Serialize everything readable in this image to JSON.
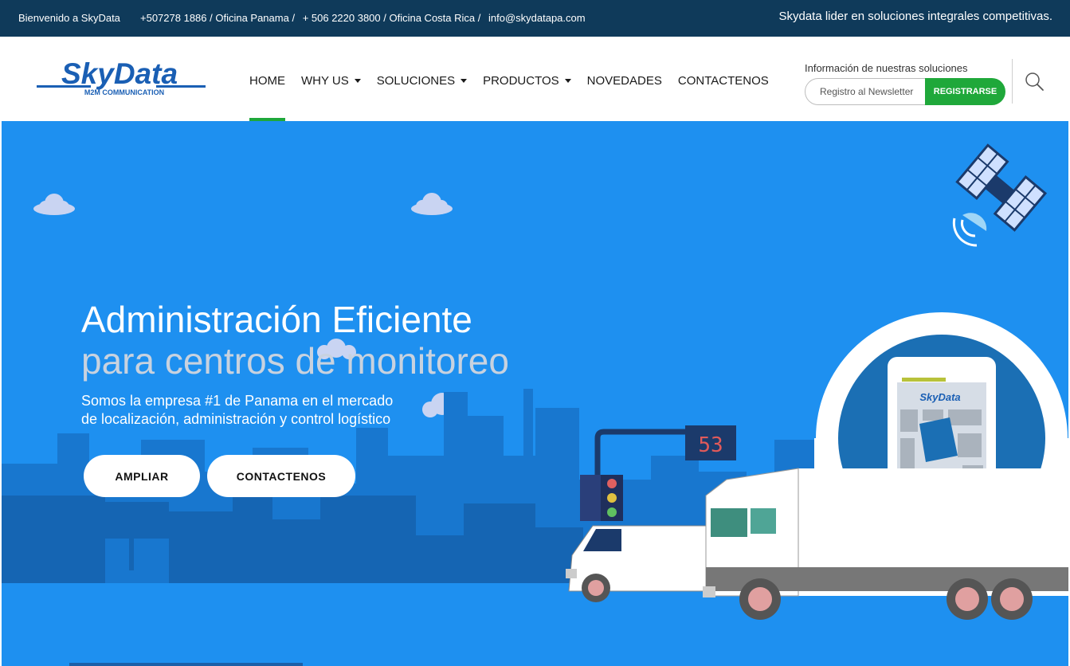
{
  "topbar": {
    "welcome": "Bienvenido a SkyData",
    "contacts": [
      "+507278 1886 / Oficina Panama /",
      "+ 506 2220 3800 / Oficina Costa Rica /",
      "info@skydatapa.com"
    ],
    "tagline": "Skydata lider en soluciones integrales competitivas."
  },
  "header": {
    "logo_text": "SkyData",
    "logo_tagline": "M2M COMMUNICATION",
    "nav": [
      {
        "label": "HOME",
        "dropdown": false,
        "active": true
      },
      {
        "label": "WHY US",
        "dropdown": true
      },
      {
        "label": "SOLUCIONES",
        "dropdown": true
      },
      {
        "label": "PRODUCTOS",
        "dropdown": true
      },
      {
        "label": "NOVEDADES",
        "dropdown": false
      },
      {
        "label": "CONTACTENOS",
        "dropdown": false
      }
    ],
    "newsletter": {
      "label": "Información de nuestras soluciones",
      "placeholder": "Registro al Newsletter",
      "button": "REGISTRARSE"
    },
    "search_icon": "search-icon"
  },
  "hero": {
    "title": "Administración Eficiente",
    "subtitle": "para centros de monitoreo",
    "description_line1": "Somos la empresa #1 de Panama en el mercado",
    "description_line2": "de localización, administración y control logístico",
    "buttons": {
      "ampliar": "AMPLIAR",
      "contact": "CONTACTENOS"
    },
    "traffic_sign": "53",
    "phone_logo": "SkyData"
  },
  "colors": {
    "topbar": "#0f3a5a",
    "accent_green": "#1fa83a",
    "hero_bg": "#1e90f0",
    "logo_blue": "#1a5fb4"
  }
}
